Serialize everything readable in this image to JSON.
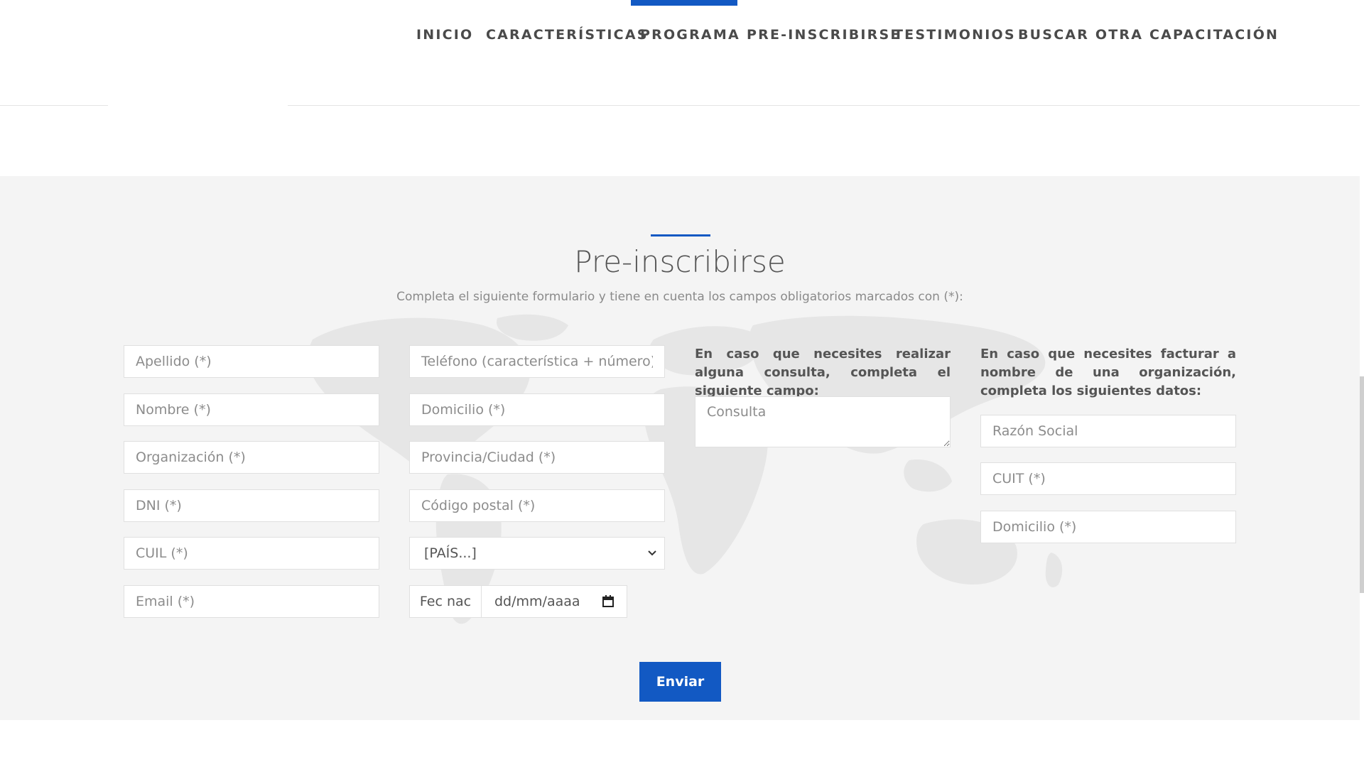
{
  "nav": {
    "items": [
      "INICIO",
      "CARACTERÍSTICAS",
      "PROGRAMA",
      "PRE-INSCRIBIRSE",
      "TESTIMONIOS",
      "BUSCAR OTRA CAPACITACIÓN"
    ],
    "active": "PROGRAMA"
  },
  "section": {
    "title": "Pre-inscribirse",
    "subtitle": "Completa el siguiente formulario y tiene en cuenta los campos obligatorios marcados con (*):"
  },
  "form": {
    "col1": {
      "apellido": "Apellido (*)",
      "nombre": "Nombre (*)",
      "organizacion": "Organización (*)",
      "dni": "DNI (*)",
      "cuil": "CUIL (*)",
      "email": "Email (*)"
    },
    "col2": {
      "telefono": "Teléfono (característica + número) (*",
      "domicilio": "Domicilio (*)",
      "provincia": "Provincia/Ciudad (*)",
      "codigo_postal": "Código postal (*)",
      "pais": "[PAÍS...]",
      "fec_nac_label": "Fec nac",
      "fec_nac_placeholder": "dd/mm/aaaa"
    },
    "col3": {
      "intro": "En caso que necesites realizar alguna consulta, completa el siguiente campo:",
      "consulta": "Consulta"
    },
    "col4": {
      "intro": "En caso que necesites facturar a nombre de una organización, completa los siguientes datos:",
      "razon_social": "Razón Social",
      "cuit": "CUIT (*)",
      "domicilio": "Domicilio (*)"
    },
    "submit_label": "Enviar"
  },
  "colors": {
    "accent": "#1259c3",
    "section_bg": "#f4f4f4"
  }
}
